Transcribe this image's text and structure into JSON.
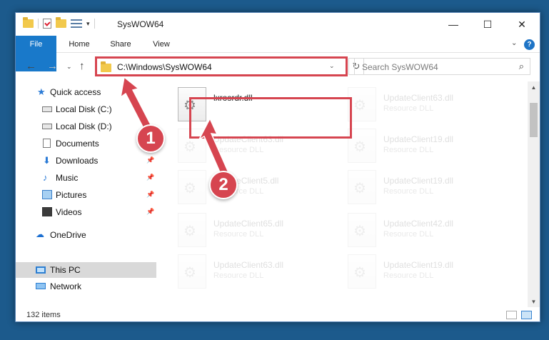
{
  "window": {
    "title": "SysWOW64",
    "controls": {
      "minimize": "—",
      "maximize": "☐",
      "close": "✕"
    }
  },
  "ribbon": {
    "tabs": [
      {
        "label": "File"
      },
      {
        "label": "Home"
      },
      {
        "label": "Share"
      },
      {
        "label": "View"
      }
    ],
    "help": "?"
  },
  "address_bar": {
    "path": "C:\\Windows\\SysWOW64"
  },
  "search": {
    "placeholder": "Search SysWOW64"
  },
  "sidebar": {
    "items": [
      {
        "label": "Quick access",
        "icon": "star-icon"
      },
      {
        "label": "Local Disk (C:)",
        "icon": "drive-icon"
      },
      {
        "label": "Local Disk (D:)",
        "icon": "drive-icon"
      },
      {
        "label": "Documents",
        "icon": "documents-icon",
        "pinned": true
      },
      {
        "label": "Downloads",
        "icon": "download-icon",
        "pinned": true
      },
      {
        "label": "Music",
        "icon": "music-icon",
        "pinned": true
      },
      {
        "label": "Pictures",
        "icon": "pictures-icon",
        "pinned": true
      },
      {
        "label": "Videos",
        "icon": "videos-icon",
        "pinned": true
      },
      {
        "label": "OneDrive",
        "icon": "cloud-icon"
      },
      {
        "label": "This PC",
        "icon": "pc-icon",
        "selected": true
      },
      {
        "label": "Network",
        "icon": "network-icon"
      }
    ]
  },
  "files": {
    "highlighted": {
      "name": "lxrosrdr.dll",
      "type": ""
    },
    "faded": [
      {
        "name": "UpdateClient63.dll",
        "type": "Resource DLL"
      },
      {
        "name": "UpdateClient63.dll",
        "type": "Resource DLL"
      },
      {
        "name": "UpdateClient19.dll",
        "type": "Resource DLL"
      },
      {
        "name": "UpdateClient5.dll",
        "type": "Resource DLL"
      },
      {
        "name": "UpdateClient19.dll",
        "type": "Resource DLL"
      },
      {
        "name": "UpdateClient65.dll",
        "type": "Resource DLL"
      },
      {
        "name": "UpdateClient42.dll",
        "type": "Resource DLL"
      },
      {
        "name": "UpdateClient63.dll",
        "type": "Resource DLL"
      },
      {
        "name": "UpdateClient19.dll",
        "type": "Resource DLL"
      }
    ]
  },
  "status_bar": {
    "item_count": "132 items"
  },
  "annotations": {
    "callout_1": "1",
    "callout_2": "2",
    "color": "#d64550"
  }
}
